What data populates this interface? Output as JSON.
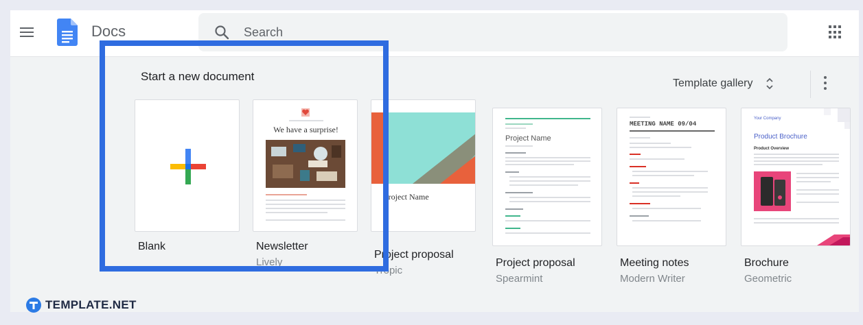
{
  "app": {
    "name": "Docs",
    "search_placeholder": "Search"
  },
  "section": {
    "title": "Start a new document",
    "gallery_label": "Template gallery"
  },
  "templates": [
    {
      "name": "Blank",
      "subtitle": ""
    },
    {
      "name": "Newsletter",
      "subtitle": "Lively"
    },
    {
      "name": "Project proposal",
      "subtitle": "Tropic"
    },
    {
      "name": "Project proposal",
      "subtitle": "Spearmint"
    },
    {
      "name": "Meeting notes",
      "subtitle": "Modern Writer"
    },
    {
      "name": "Brochure",
      "subtitle": "Geometric"
    }
  ],
  "previews": {
    "newsletter_headline": "We have a surprise!",
    "tropic_title": "Project Name",
    "spearmint_title": "Project Name",
    "meeting_title": "MEETING NAME 09/04",
    "brochure_company": "Your Company",
    "brochure_title": "Product Brochure",
    "brochure_section": "Product Overview"
  },
  "watermark": {
    "text": "TEMPLATE.NET"
  },
  "colors": {
    "highlight": "#2f6ce0",
    "docs_blue": "#4285f4",
    "plus_red": "#ea4335",
    "plus_yellow": "#fbbc04",
    "plus_green": "#34a853",
    "tropic_teal": "#7fd4cb",
    "tropic_orange": "#e8613c",
    "spearmint_green": "#3fb68b",
    "meeting_red": "#d93025",
    "brochure_pink": "#e8457a",
    "brochure_blue": "#4a60c8"
  }
}
